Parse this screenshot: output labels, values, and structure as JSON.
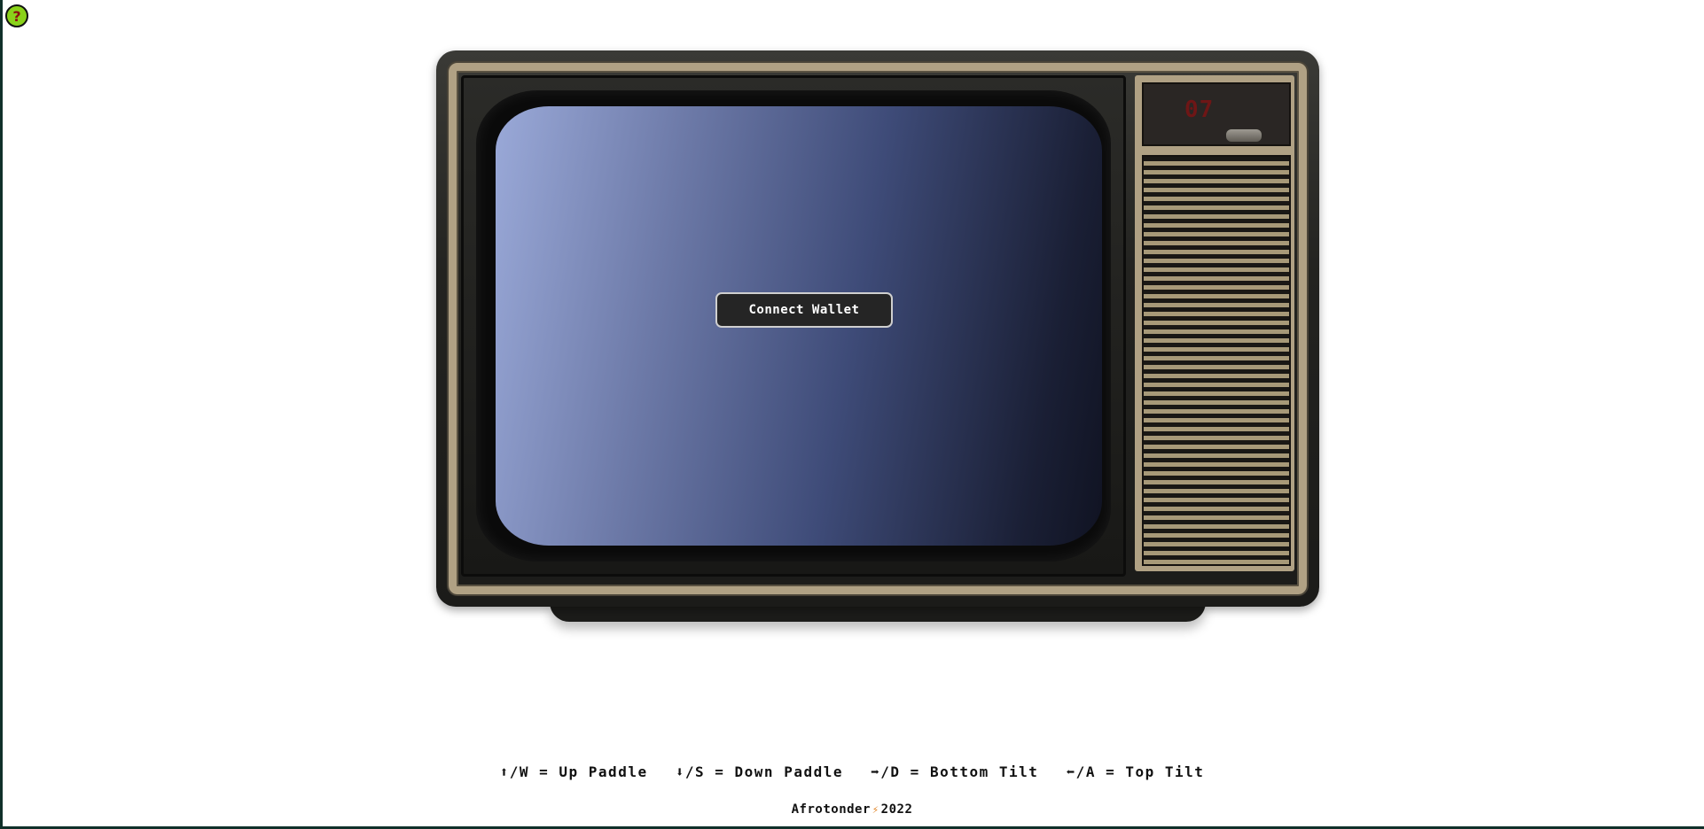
{
  "help": {
    "label": "?"
  },
  "tv": {
    "channel_display": "07"
  },
  "screen": {
    "connect_label": "Connect Wallet"
  },
  "controls": [
    "⬆/W = Up Paddle",
    "⬇/S = Down Paddle",
    "➡/D = Bottom Tilt",
    "⬅/A = Top Tilt"
  ],
  "footer": {
    "author": "Afrotonder",
    "mark": "⚡",
    "year": "2022"
  },
  "colors": {
    "help_bg": "#8ad21a",
    "led": "#6e1616",
    "trim": "#b0a184"
  }
}
